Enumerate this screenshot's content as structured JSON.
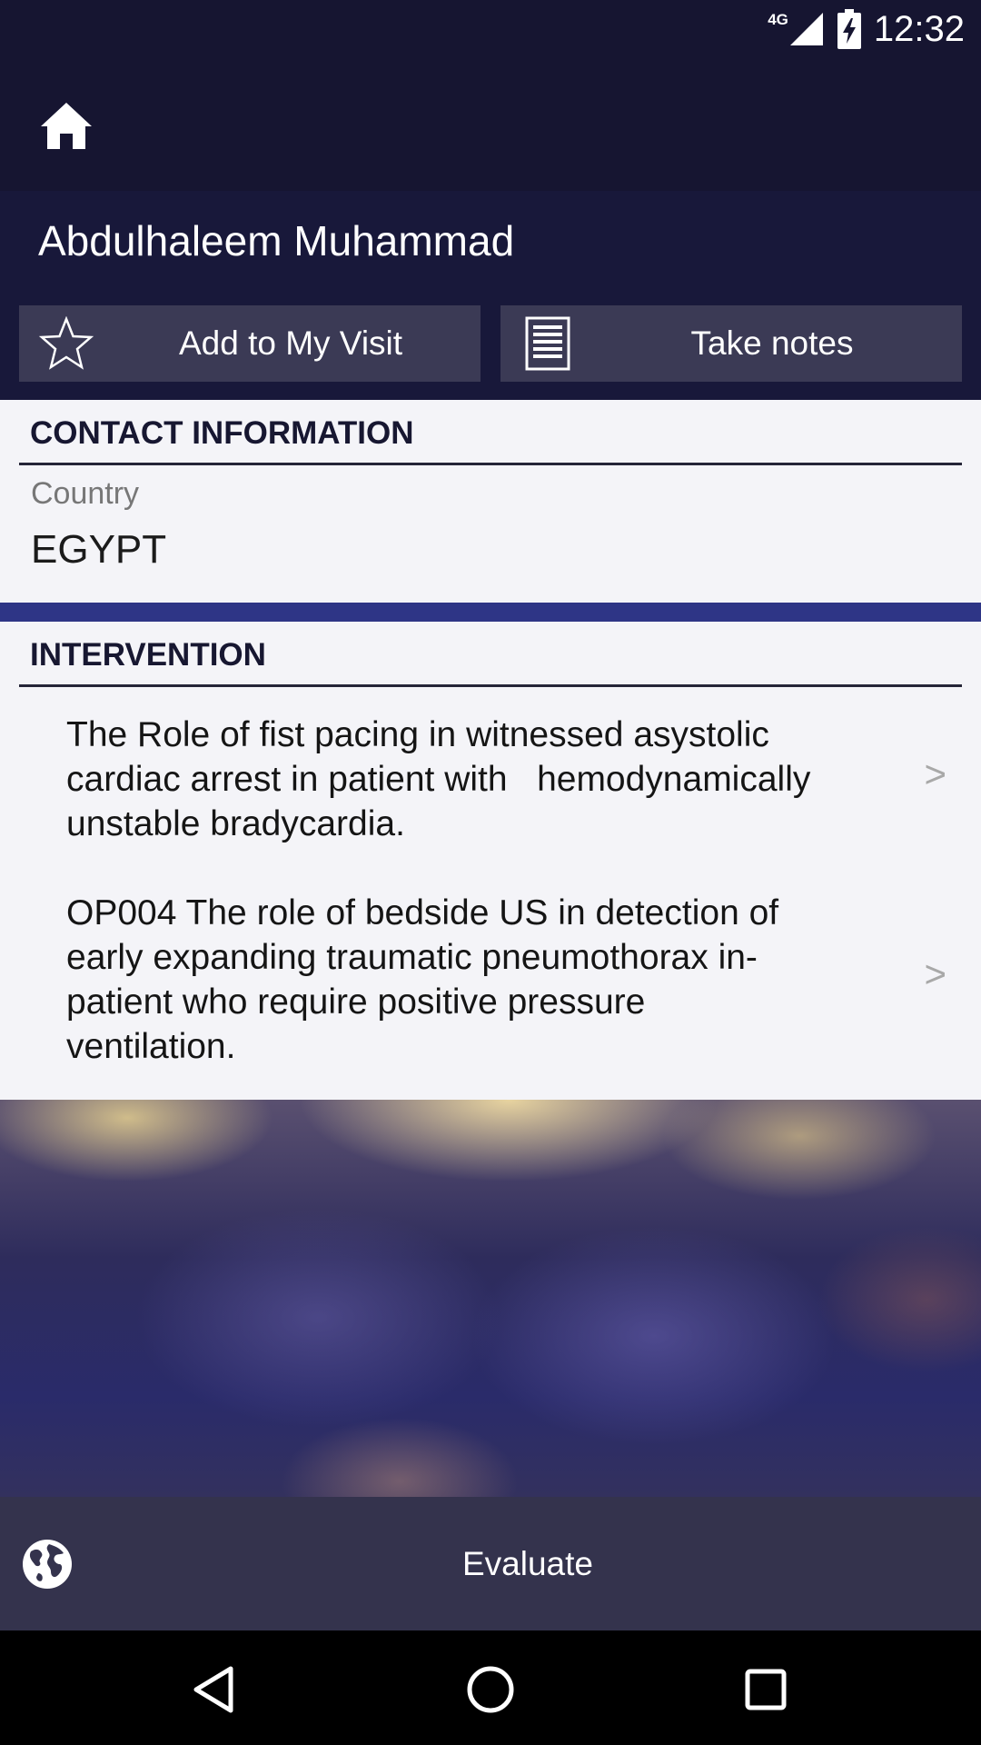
{
  "status_bar": {
    "network": "4G",
    "time": "12:32"
  },
  "header": {
    "person_name": "Abdulhaleem Muhammad"
  },
  "actions": {
    "add_visit_label": "Add to My Visit",
    "take_notes_label": "Take notes"
  },
  "contact": {
    "heading": "CONTACT INFORMATION",
    "country_label": "Country",
    "country_value": "EGYPT"
  },
  "intervention": {
    "heading": "INTERVENTION",
    "items": [
      {
        "lines": [
          "The Role of fist pacing in witnessed asystolic",
          "cardiac arrest in patient with   hemodynamically",
          "unstable bradycardia."
        ],
        "chevron": ">"
      },
      {
        "lines": [
          "OP004 The role of bedside US in detection of",
          "early expanding traumatic pneumothorax in-",
          "patient who require positive pressure",
          "ventilation."
        ],
        "chevron": ">"
      }
    ]
  },
  "footer": {
    "evaluate_label": "Evaluate"
  },
  "colors": {
    "header_bg": "#161531",
    "title_bg": "#18183a",
    "button_bg": "#3b3a55",
    "accent": "#2e3586",
    "panel_bg": "#f4f4f8",
    "footer_bg": "#34334d"
  },
  "icons": [
    "home-icon",
    "star-icon",
    "notes-icon",
    "chevron-right-icon",
    "globe-icon",
    "back-icon",
    "home-circle-icon",
    "recents-icon"
  ]
}
